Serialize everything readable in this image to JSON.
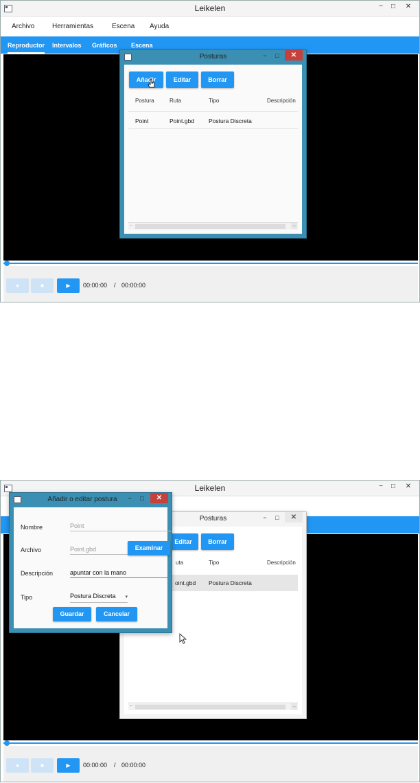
{
  "app": {
    "title": "Leikelen",
    "window_controls": {
      "minimize": "−",
      "maximize": "□",
      "close": "✕"
    },
    "menu": [
      "Archivo",
      "Herramientas",
      "Escena",
      "Ayuda"
    ],
    "tabs": [
      "Reproductor",
      "Intervalos",
      "Gráficos",
      "Escena"
    ],
    "player": {
      "current_time": "00:00:00",
      "separator": "/",
      "total_time": "00:00:00",
      "record_icon": "●",
      "stop_icon": "■",
      "play_icon": "▶"
    }
  },
  "posturas_dialog": {
    "title": "Posturas",
    "controls": {
      "minimize": "−",
      "maximize": "□",
      "close": "✕"
    },
    "buttons": {
      "add": "Añadir",
      "edit": "Editar",
      "delete": "Borrar"
    },
    "columns": [
      "Postura",
      "Ruta",
      "Tipo",
      "Descripción"
    ],
    "rows": [
      {
        "postura": "Point",
        "ruta": "Point.gbd",
        "tipo": "Postura Discreta",
        "descripcion": ""
      }
    ],
    "partial_row": {
      "ruta": "oint.gbd",
      "tipo": "Postura Discreta"
    },
    "partial_edit": "Editar",
    "partial_column": "uta",
    "scroll_left": "←",
    "scroll_right": "→"
  },
  "edit_dialog": {
    "title": "Añadir o editar postura",
    "controls": {
      "minimize": "−",
      "maximize": "□",
      "close": "✕"
    },
    "fields": {
      "nombre_label": "Nombre",
      "nombre_value": "Point",
      "archivo_label": "Archivo",
      "archivo_value": "Point.gbd",
      "examinar": "Examinar",
      "descripcion_label": "Descripción",
      "descripcion_value": "apuntar con la mano",
      "tipo_label": "Tipo",
      "tipo_value": "Postura Discreta",
      "tipo_arrow": "▾"
    },
    "buttons": {
      "save": "Guardar",
      "cancel": "Cancelar"
    }
  },
  "colors": {
    "accent": "#2196f3",
    "dialog_frame": "#3b8fb3",
    "close_red": "#c7403a",
    "video_bg": "#000000"
  }
}
